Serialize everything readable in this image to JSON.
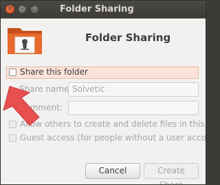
{
  "window": {
    "title": "Folder Sharing"
  },
  "dialog": {
    "title": "Folder Sharing",
    "share_folder_label": "Share this folder",
    "share_name_label": "Share name:",
    "share_name_value": "Solvetic",
    "comment_label": "Comment:",
    "comment_value": "",
    "allow_others_label": "Allow others to create and delete files in this folder",
    "guest_access_label": "Guest access (for people without a user account)"
  },
  "buttons": {
    "cancel": "Cancel",
    "create_share": "Create Share"
  },
  "colors": {
    "titlebar": "#3c3b37",
    "close_button": "#df4a16",
    "highlight": "#fbe3d9",
    "arrow": "#e84f4f",
    "folder": "#e86a2c"
  }
}
